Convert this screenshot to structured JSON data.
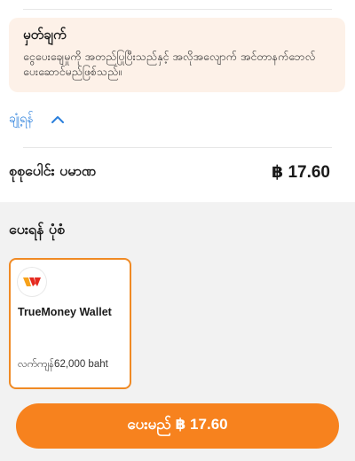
{
  "notice": {
    "title": "မှတ်ချက်",
    "text": "ငွေပေးချေမှုကို အတည်ပြုပြီးသည်နှင့် အလိုအလျောက် အင်တာနက်ဘေလ် ပေးဆောင်မည်ဖြစ်သည်။"
  },
  "summary": {
    "collapse_label": "ချုံ့ရန်",
    "total_label": "စုစုပေါင်း ပမာဏ",
    "total_amount": "฿ 17.60"
  },
  "payment": {
    "section_title": "ပေးရန် ပုံစံ",
    "method": {
      "name": "TrueMoney Wallet",
      "balance": "လက်ကျန်62,000 baht",
      "icon": "truemoney-logo-icon"
    }
  },
  "pay_button": {
    "label": "ပေးမည် ฿ 17.60"
  },
  "colors": {
    "accent": "#f7821e",
    "link": "#2a7fdc",
    "notice_bg": "#fdf1e8"
  }
}
